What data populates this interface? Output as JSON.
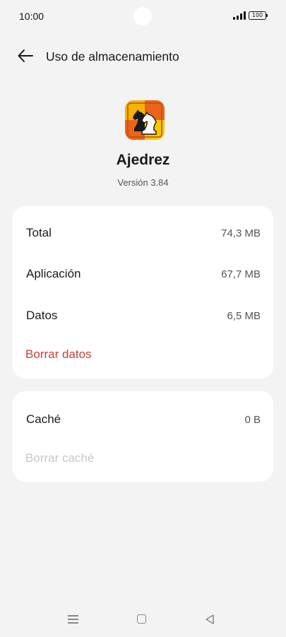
{
  "status_bar": {
    "time": "10:00",
    "battery": "100",
    "icons": [
      "signal-icon",
      "battery-icon"
    ]
  },
  "header": {
    "title": "Uso de almacenamiento",
    "back_icon": "arrow-left-icon"
  },
  "app": {
    "name": "Ajedrez",
    "version": "Versión 3.84",
    "icon": "chess-knight-app-icon"
  },
  "storage": {
    "rows": [
      {
        "label": "Total",
        "value": "74,3 MB"
      },
      {
        "label": "Aplicación",
        "value": "67,7 MB"
      },
      {
        "label": "Datos",
        "value": "6,5 MB"
      }
    ],
    "clear_data_label": "Borrar datos"
  },
  "cache": {
    "label": "Caché",
    "value": "0 B",
    "clear_cache_label": "Borrar caché"
  },
  "nav_bar": {
    "icons": [
      "menu-icon",
      "home-icon",
      "back-icon"
    ]
  },
  "colors": {
    "background": "#f3f3f3",
    "card": "#ffffff",
    "danger": "#d23b36",
    "disabled": "#c8c8c8",
    "secondary_text": "#555555"
  }
}
